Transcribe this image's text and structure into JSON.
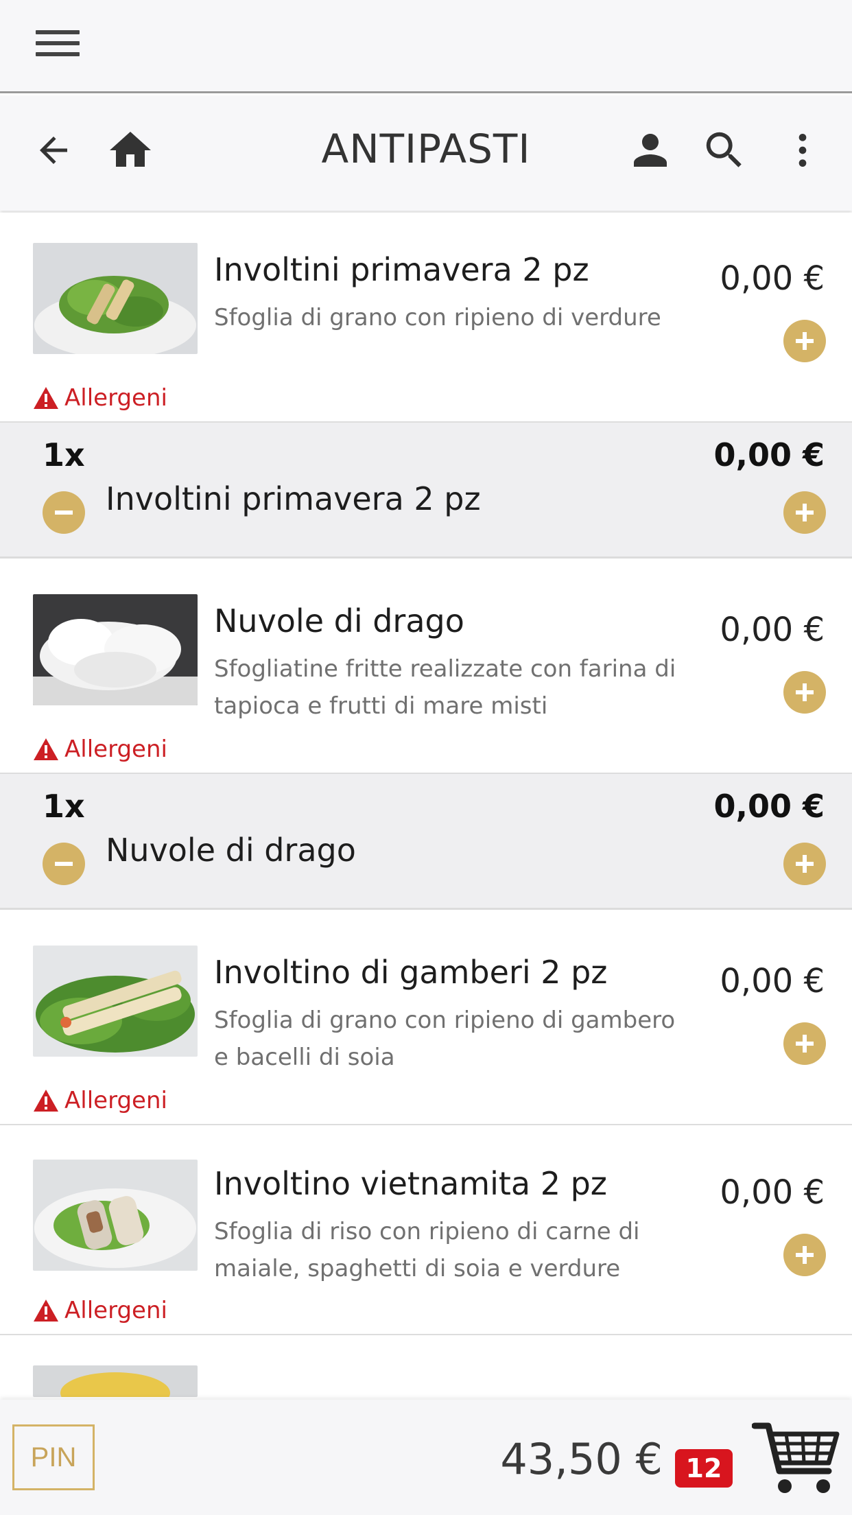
{
  "header": {
    "title": "ANTIPASTI"
  },
  "items": [
    {
      "name": "Involtini primavera 2 pz",
      "description": "Sfoglia di grano con ripieno di verdure",
      "price": "0,00 €",
      "allergen_label": "Allergeni",
      "image": "spring-rolls-on-lettuce"
    },
    {
      "name": "Nuvole di drago",
      "description": "Sfogliatine fritte realizzate con farina di tapioca e frutti di mare misti",
      "price": "0,00 €",
      "allergen_label": "Allergeni",
      "image": "prawn-crackers"
    },
    {
      "name": "Involtino di gamberi 2 pz",
      "description": "Sfoglia di grano con ripieno di gambero e bacelli di soia",
      "price": "0,00 €",
      "allergen_label": "Allergeni",
      "image": "shrimp-rolls-on-lettuce"
    },
    {
      "name": "Involtino vietnamita 2 pz",
      "description": "Sfoglia di riso con ripieno di carne di maiale, spaghetti di soia e verdure",
      "price": "0,00 €",
      "allergen_label": "Allergeni",
      "image": "vietnamese-rolls"
    }
  ],
  "cart_lines": [
    {
      "qty": "1x",
      "name": "Involtini primavera 2 pz",
      "price": "0,00 €"
    },
    {
      "qty": "1x",
      "name": "Nuvole di drago",
      "price": "0,00 €"
    }
  ],
  "footer": {
    "pin_label": "PIN",
    "total": "43,50 €",
    "cart_count": "12"
  },
  "colors": {
    "accent": "#d4b366",
    "allergen": "#cc1f24",
    "badge": "#d8151e",
    "cart_row_bg": "#efeff1"
  },
  "icons": [
    "hamburger-menu-icon",
    "back-arrow-icon",
    "home-icon",
    "user-icon",
    "search-icon",
    "more-vert-icon",
    "plus-icon",
    "minus-icon",
    "warning-icon",
    "shopping-cart-icon"
  ]
}
